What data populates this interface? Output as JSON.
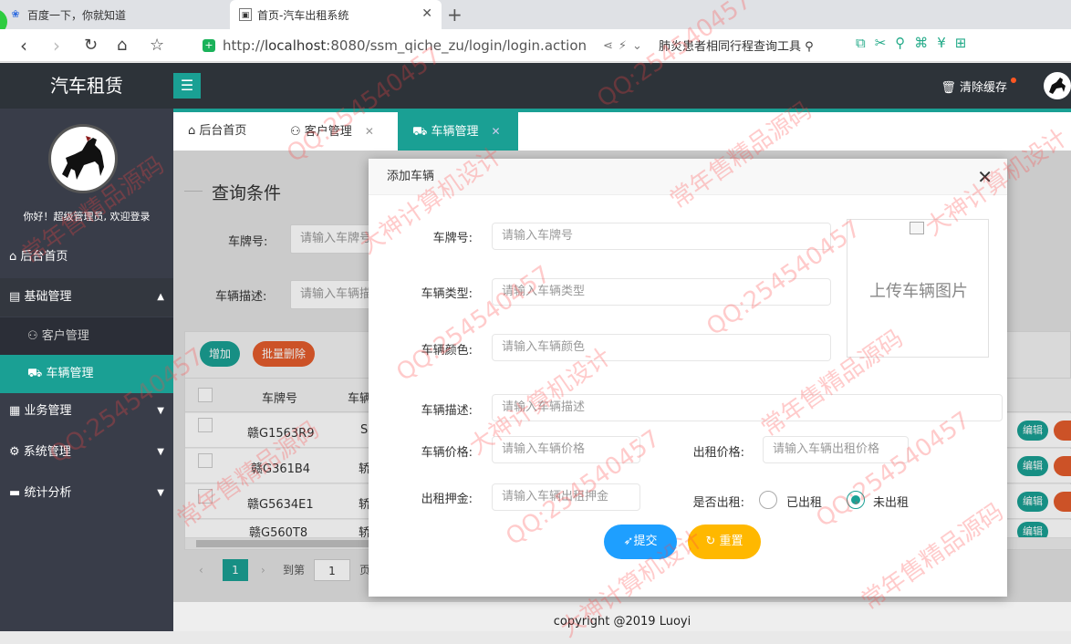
{
  "browser": {
    "tabs": [
      {
        "title": "百度一下，你就知道"
      },
      {
        "title": "首页-汽车出租系统"
      }
    ],
    "url_prefix": "http://",
    "url_host": "localhost",
    "url_rest": ":8080/ssm_qiche_zu/login/login.action",
    "search_text": "肺炎患者相同行程查询工具"
  },
  "header": {
    "brand": "汽车租赁",
    "clear_cache": "清除缓存"
  },
  "sidebar": {
    "welcome": "你好！超级管理员, 欢迎登录",
    "items": [
      {
        "label": "后台首页",
        "icon": "⌂"
      },
      {
        "label": "基础管理",
        "icon": "▤",
        "arrow": "▲"
      },
      {
        "label": "客户管理",
        "icon": "⚇"
      },
      {
        "label": "车辆管理",
        "icon": "⛟"
      },
      {
        "label": "业务管理",
        "icon": "▦",
        "arrow": "▼"
      },
      {
        "label": "系统管理",
        "icon": "⚙",
        "arrow": "▼"
      },
      {
        "label": "统计分析",
        "icon": "▬",
        "arrow": "▼"
      }
    ]
  },
  "content_tabs": [
    {
      "label": "后台首页",
      "icon": "⌂"
    },
    {
      "label": "客户管理",
      "icon": "⚇"
    },
    {
      "label": "车辆管理",
      "icon": "⛟"
    }
  ],
  "query": {
    "title": "查询条件",
    "plate_label": "车牌号:",
    "plate_placeholder": "请输入车牌号",
    "desc_label": "车辆描述:",
    "desc_placeholder": "请输入车辆描"
  },
  "table": {
    "add_label": "增加",
    "batch_delete_label": "批量删除",
    "columns": [
      "车牌号",
      "车辆"
    ],
    "rows": [
      {
        "plate": "赣G1563R9",
        "type": "S"
      },
      {
        "plate": "赣G361B4",
        "type": "轿"
      },
      {
        "plate": "赣G5634E1",
        "type": "轿"
      },
      {
        "plate": "赣G560T8",
        "type": "轿"
      }
    ],
    "edit_label": "编辑",
    "pager": {
      "current": "1",
      "goto_label": "到第",
      "goto_value": "1",
      "page_suffix": "页"
    }
  },
  "modal": {
    "title": "添加车辆",
    "fields": {
      "plate": {
        "label": "车牌号:",
        "placeholder": "请输入车牌号"
      },
      "type": {
        "label": "车辆类型:",
        "placeholder": "请输入车辆类型"
      },
      "color": {
        "label": "车辆颜色:",
        "placeholder": "请输入车辆颜色"
      },
      "desc": {
        "label": "车辆描述:",
        "placeholder": "请输入车辆描述"
      },
      "price": {
        "label": "车辆价格:",
        "placeholder": "请输入车辆价格"
      },
      "rent_price": {
        "label": "出租价格:",
        "placeholder": "请输入车辆出租价格"
      },
      "deposit": {
        "label": "出租押金:",
        "placeholder": "请输入车辆出租押金"
      },
      "is_rented": {
        "label": "是否出租:",
        "options": [
          "已出租",
          "未出租"
        ],
        "selected": "未出租"
      }
    },
    "upload_text": "上传车辆图片",
    "submit_label": "提交",
    "reset_label": "重置"
  },
  "footer": {
    "copyright": "copyright @2019 Luoyi"
  },
  "watermarks": [
    "QQ:254540457",
    "常年售精品源码",
    "大神计算机设计"
  ],
  "colors": {
    "accent": "#1aa094",
    "sidebar": "#393d49",
    "header": "#2d3339",
    "submit": "#1e9fff",
    "reset": "#ffb800",
    "danger": "#e45c2c"
  }
}
